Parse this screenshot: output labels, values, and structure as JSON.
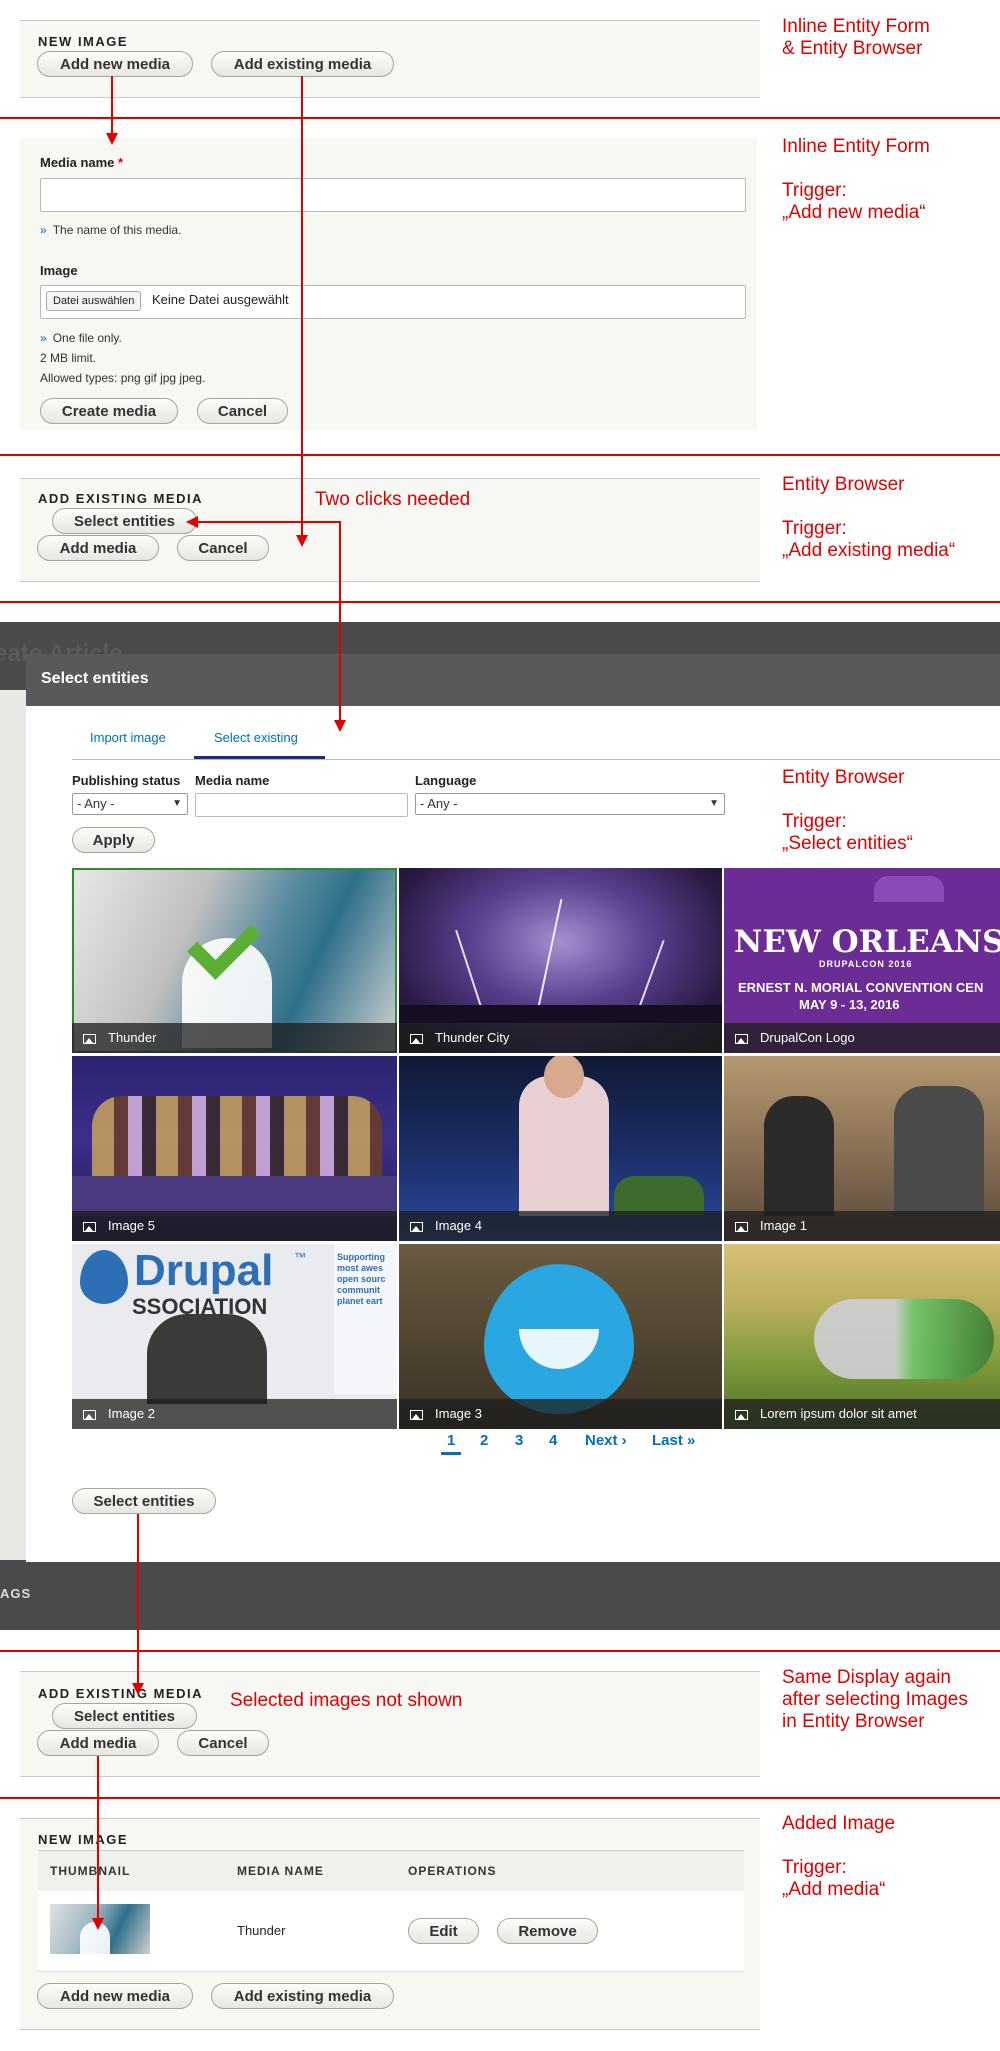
{
  "section1": {
    "title": "NEW IMAGE",
    "add_new_label": "Add new media",
    "add_existing_label": "Add existing media",
    "note": "Inline Entity Form\n& Entity Browser"
  },
  "section2": {
    "media_name_label": "Media name",
    "required_mark": "*",
    "media_name_value": "",
    "media_name_desc": "The name of this media.",
    "image_label": "Image",
    "file_button": "Datei auswählen",
    "file_status": "Keine Datei ausgewählt",
    "desc_one_file": "One file only.",
    "desc_limit": "2 MB limit.",
    "desc_types": "Allowed types: png gif jpg jpeg.",
    "create_label": "Create media",
    "cancel_label": "Cancel",
    "note": "Inline Entity Form\n\nTrigger:\n„Add new media“"
  },
  "section3": {
    "title": "ADD EXISTING MEDIA",
    "select_label": "Select entities",
    "add_label": "Add media",
    "cancel_label": "Cancel",
    "annotation": "Two clicks needed",
    "note": "Entity Browser\n\nTrigger:\n„Add existing media“"
  },
  "modal": {
    "title": "Select entities",
    "background_title": "eate Article",
    "tabs": [
      "Import image",
      "Select existing"
    ],
    "active_tab": "Select existing",
    "filters": {
      "status_label": "Publishing status",
      "status_value": "- Any -",
      "name_label": "Media name",
      "name_value": "",
      "language_label": "Language",
      "language_value": "- Any -"
    },
    "apply_label": "Apply",
    "tiles": [
      {
        "name": "Thunder",
        "selected": true
      },
      {
        "name": "Thunder City",
        "selected": false
      },
      {
        "name": "DrupalCon Logo",
        "selected": false
      },
      {
        "name": "Image 5",
        "selected": false
      },
      {
        "name": "Image 4",
        "selected": false
      },
      {
        "name": "Image 1",
        "selected": false
      },
      {
        "name": "Image 2",
        "selected": false
      },
      {
        "name": "Image 3",
        "selected": false
      },
      {
        "name": "Lorem ipsum dolor sit amet",
        "selected": false
      }
    ],
    "logo_text": {
      "line1": "NEW ORLEANS",
      "line2": "DRUPALCON 2016",
      "line3": "ERNEST N. MORIAL CONVENTION CEN",
      "line4": "MAY 9 - 13, 2016"
    },
    "assoc_text": {
      "brand": "Drupal",
      "tm": "™",
      "assoc": "SSOCIATION",
      "side": "Supporting\nmost awes\nopen sourc\ncommunit\nplanet eart"
    },
    "pager": {
      "pages": [
        "1",
        "2",
        "3",
        "4"
      ],
      "current": "1",
      "next": "Next ›",
      "last": "Last »"
    },
    "select_entities_label": "Select entities",
    "background_label": "AGS",
    "note": "Entity Browser\n\nTrigger:\n„Select entities“"
  },
  "section4": {
    "title": "ADD EXISTING MEDIA",
    "select_label": "Select entities",
    "add_label": "Add media",
    "cancel_label": "Cancel",
    "annotation": "Selected images not shown",
    "note": "Same Display again\nafter selecting Images\nin Entity Browser"
  },
  "section5": {
    "title": "NEW IMAGE",
    "columns": [
      "THUMBNAIL",
      "MEDIA NAME",
      "OPERATIONS"
    ],
    "row": {
      "media_name": "Thunder",
      "edit_label": "Edit",
      "remove_label": "Remove"
    },
    "add_new_label": "Add new media",
    "add_existing_label": "Add existing media",
    "note": "Added Image\n\nTrigger:\n„Add media“"
  },
  "colors": {
    "annotation": "#e00000",
    "link": "#0071b8",
    "selected_border": "#2e8b2e"
  }
}
